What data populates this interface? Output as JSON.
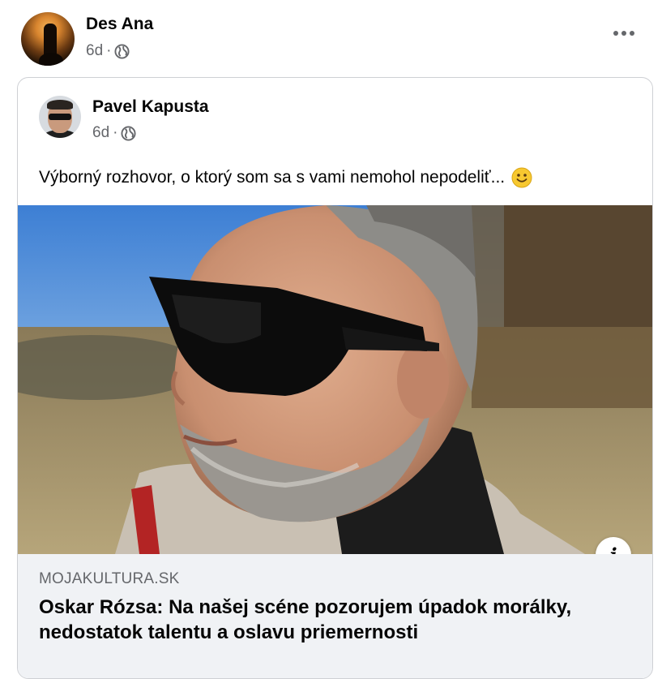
{
  "post": {
    "author": "Des Ana",
    "time": "6d",
    "separator": "·",
    "privacy_icon": "globe-icon",
    "more_icon": "more-options-icon"
  },
  "shared_post": {
    "author": "Pavel Kapusta",
    "time": "6d",
    "separator": "·",
    "privacy_icon": "globe-icon",
    "text": "Výborný rozhovor, o ktorý som sa s vami nemohol nepodeliť...",
    "emoji": "smiley-emoji"
  },
  "link_preview": {
    "domain": "MOJAKULTURA.SK",
    "headline": "Oskar Rózsa: Na našej scéne pozorujem úpadok morálky, nedostatok talentu a oslavu priemernosti",
    "info_label": "i"
  }
}
